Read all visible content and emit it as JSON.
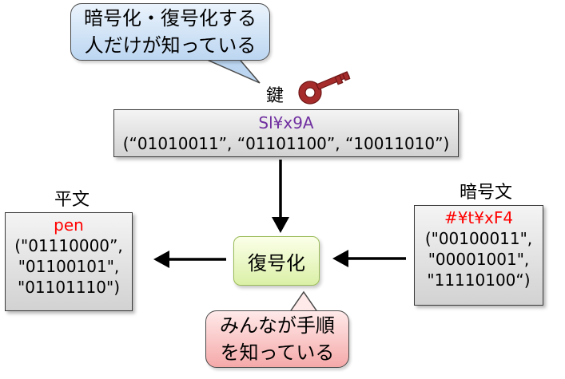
{
  "callouts": {
    "top": "暗号化・復号化する\n人だけが知っている",
    "bottom": "みんなが手順\nを知っている"
  },
  "key": {
    "label": "鍵",
    "icon": "key-icon",
    "value": "Sl¥x9A",
    "bits": "(“01010011”, “01101100”, “10011010”)",
    "value_color": "#7030a0"
  },
  "plaintext": {
    "label": "平文",
    "value": "pen",
    "bits": [
      "(\"01110000”,",
      "\"01100101\",",
      "\"01101110\")"
    ],
    "value_color": "#ff0000"
  },
  "ciphertext": {
    "label": "暗号文",
    "value": "#¥t¥xF4",
    "bits": [
      "(\"00100011\",",
      "\"00001001\",",
      "\"11110100“)"
    ],
    "value_color": "#ff0000"
  },
  "process": {
    "label": "復号化"
  }
}
